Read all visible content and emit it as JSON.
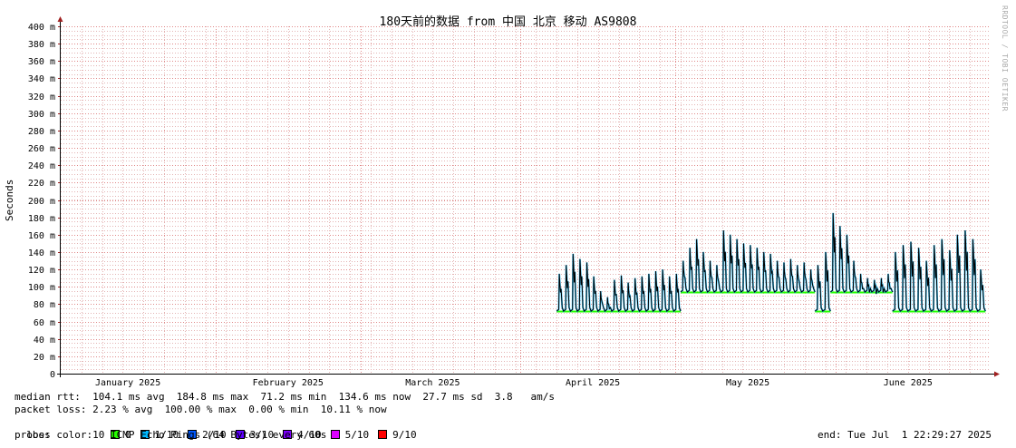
{
  "title": "180天前的数据 from 中国 北京 移动 AS9808",
  "watermark": "RRDTOOL / TOBI OETIKER",
  "colors": {
    "grid_minor": "#e4b4b4",
    "grid_major": "#e08888",
    "axis": "#000000",
    "arrow": "#a02020",
    "median_line": "#000000",
    "loss_0": "#26ff00",
    "loss_1": "#00b8ff"
  },
  "chart_data": {
    "type": "line",
    "title": "180天前的数据 from 中国 北京 移动 AS9808",
    "ylabel": "Seconds",
    "xlabel": "",
    "ylim": [
      0,
      0.4
    ],
    "y_ticks": [
      {
        "value": 0,
        "label": "0"
      },
      {
        "value": 0.02,
        "label": "20 m"
      },
      {
        "value": 0.04,
        "label": "40 m"
      },
      {
        "value": 0.06,
        "label": "60 m"
      },
      {
        "value": 0.08,
        "label": "80 m"
      },
      {
        "value": 0.1,
        "label": "100 m"
      },
      {
        "value": 0.12,
        "label": "120 m"
      },
      {
        "value": 0.14,
        "label": "140 m"
      },
      {
        "value": 0.16,
        "label": "160 m"
      },
      {
        "value": 0.18,
        "label": "180 m"
      },
      {
        "value": 0.2,
        "label": "200 m"
      },
      {
        "value": 0.22,
        "label": "220 m"
      },
      {
        "value": 0.24,
        "label": "240 m"
      },
      {
        "value": 0.26,
        "label": "260 m"
      },
      {
        "value": 0.28,
        "label": "280 m"
      },
      {
        "value": 0.3,
        "label": "300 m"
      },
      {
        "value": 0.32,
        "label": "320 m"
      },
      {
        "value": 0.34,
        "label": "340 m"
      },
      {
        "value": 0.36,
        "label": "360 m"
      },
      {
        "value": 0.38,
        "label": "380 m"
      },
      {
        "value": 0.4,
        "label": "400 m"
      }
    ],
    "xlim": [
      "2025-01-02",
      "2025-07-01"
    ],
    "x_ticks": [
      {
        "date": "2025-01-15",
        "label": "January 2025"
      },
      {
        "date": "2025-02-15",
        "label": "February 2025"
      },
      {
        "date": "2025-03-15",
        "label": "March 2025"
      },
      {
        "date": "2025-04-15",
        "label": "April 2025"
      },
      {
        "date": "2025-05-15",
        "label": "May 2025"
      },
      {
        "date": "2025-06-15",
        "label": "June 2025"
      }
    ],
    "grid": true,
    "segments": [
      {
        "start": "2025-04-08",
        "end": "2025-05-02",
        "baseline": 0.072,
        "peaks": [
          0.115,
          0.125,
          0.138,
          0.132,
          0.128,
          0.112,
          0.095,
          0.088,
          0.108,
          0.113,
          0.105,
          0.11,
          0.112,
          0.115,
          0.118,
          0.12,
          0.112,
          0.115
        ]
      },
      {
        "start": "2025-05-02",
        "end": "2025-05-28",
        "baseline": 0.094,
        "peaks": [
          0.13,
          0.145,
          0.155,
          0.14,
          0.13,
          0.125,
          0.165,
          0.16,
          0.155,
          0.15,
          0.148,
          0.145,
          0.14,
          0.138,
          0.13,
          0.128,
          0.132,
          0.125,
          0.128,
          0.12
        ]
      },
      {
        "start": "2025-05-28",
        "end": "2025-05-31",
        "baseline": 0.072,
        "peaks": [
          0.125,
          0.14
        ]
      },
      {
        "start": "2025-05-31",
        "end": "2025-06-12",
        "baseline": 0.094,
        "peaks": [
          0.185,
          0.17,
          0.16,
          0.13,
          0.115,
          0.11,
          0.108,
          0.11,
          0.115
        ]
      },
      {
        "start": "2025-06-12",
        "end": "2025-06-30",
        "baseline": 0.072,
        "peaks": [
          0.14,
          0.148,
          0.152,
          0.145,
          0.13,
          0.148,
          0.155,
          0.142,
          0.16,
          0.165,
          0.155,
          0.12
        ]
      }
    ]
  },
  "stats": {
    "median_rtt": "median rtt:  104.1 ms avg  184.8 ms max  71.2 ms min  134.6 ms now  27.7 ms sd  3.8   am/s",
    "packet_loss": "packet loss: 2.23 % avg  100.00 % max  0.00 % min  10.11 % now",
    "loss_color_label": "loss color:",
    "loss_colors": [
      {
        "label": "0",
        "color": "#26ff00"
      },
      {
        "label": "1/10",
        "color": "#00b8ff"
      },
      {
        "label": "2/10",
        "color": "#0059ff"
      },
      {
        "label": "3/10",
        "color": "#5e00ff"
      },
      {
        "label": "4/10",
        "color": "#7e00ff"
      },
      {
        "label": "5/10",
        "color": "#dd00ff"
      },
      {
        "label": "9/10",
        "color": "#ff0000"
      }
    ],
    "probe": "probe:       10 ICMP Echo Pings (64 Bytes) every 60s",
    "end": "end: Tue Jul  1 22:29:27 2025"
  }
}
